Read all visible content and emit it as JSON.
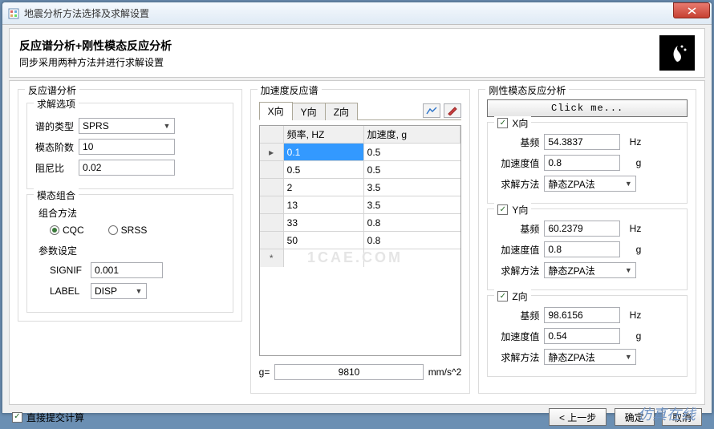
{
  "window": {
    "title": "地震分析方法选择及求解设置"
  },
  "header": {
    "title": "反应谱分析+刚性模态反应分析",
    "subtitle": "同步采用两种方法并进行求解设置"
  },
  "left": {
    "group_title": "反应谱分析",
    "solve_opts": {
      "title": "求解选项",
      "spectrum_type_label": "谱的类型",
      "spectrum_type": "SPRS",
      "modes_label": "模态阶数",
      "modes": "10",
      "damping_label": "阻尼比",
      "damping": "0.02"
    },
    "comb": {
      "title": "模态组合",
      "method_label": "组合方法",
      "cqc": "CQC",
      "srss": "SRSS",
      "param_label": "参数设定",
      "signif_label": "SIGNIF",
      "signif": "0.001",
      "output_label": "LABEL",
      "output": "DISP"
    }
  },
  "mid": {
    "group_title": "加速度反应谱",
    "tabs": {
      "x": "X向",
      "y": "Y向",
      "z": "Z向"
    },
    "grid_headers": {
      "freq": "频率, HZ",
      "acc": "加速度, g"
    },
    "rows": [
      {
        "f": "0.1",
        "a": "0.5"
      },
      {
        "f": "0.5",
        "a": "0.5"
      },
      {
        "f": "2",
        "a": "3.5"
      },
      {
        "f": "13",
        "a": "3.5"
      },
      {
        "f": "33",
        "a": "0.8"
      },
      {
        "f": "50",
        "a": "0.8"
      }
    ],
    "g_label": "g=",
    "g_value": "9810",
    "g_unit": "mm/s^2"
  },
  "right": {
    "group_title": "刚性模态反应分析",
    "click_me": "Click me...",
    "hz": "Hz",
    "g": "g",
    "x": {
      "chk": "X向",
      "freq_label": "基频",
      "freq": "54.3837",
      "acc_label": "加速度值",
      "acc": "0.8",
      "method_label": "求解方法",
      "method": "静态ZPA法"
    },
    "y": {
      "chk": "Y向",
      "freq_label": "基频",
      "freq": "60.2379",
      "acc_label": "加速度值",
      "acc": "0.8",
      "method_label": "求解方法",
      "method": "静态ZPA法"
    },
    "z": {
      "chk": "Z向",
      "freq_label": "基频",
      "freq": "98.6156",
      "acc_label": "加速度值",
      "acc": "0.54",
      "method_label": "求解方法",
      "method": "静态ZPA法"
    }
  },
  "footer": {
    "submit_chk": "直接提交计算",
    "prev": "< 上一步",
    "ok": "确定",
    "cancel": "取消"
  },
  "watermark": "仿真在线"
}
